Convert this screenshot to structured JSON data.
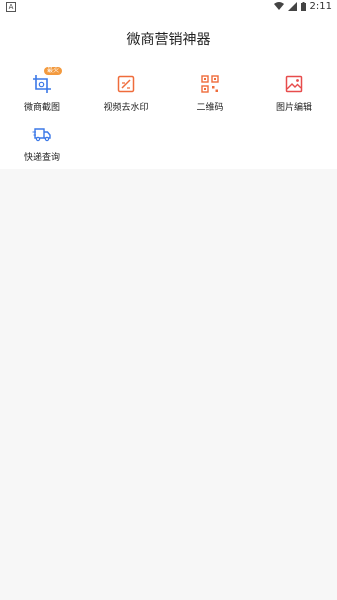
{
  "status_bar": {
    "time": "2:11",
    "left_icon": "app-notification-icon",
    "right_icons": [
      "wifi-icon",
      "cell-signal-icon",
      "battery-icon"
    ]
  },
  "header": {
    "title": "微商营销神器"
  },
  "tools": [
    {
      "label": "微商截图",
      "icon": "screenshot-icon",
      "color": "#3b78e7",
      "badge": "最火"
    },
    {
      "label": "视频去水印",
      "icon": "watermark-remove-icon",
      "color": "#ef6c3b"
    },
    {
      "label": "二维码",
      "icon": "qr-code-icon",
      "color": "#ef6c3b"
    },
    {
      "label": "图片编辑",
      "icon": "image-edit-icon",
      "color": "#e74c4c"
    },
    {
      "label": "快递查询",
      "icon": "delivery-truck-icon",
      "color": "#3b78e7"
    }
  ]
}
